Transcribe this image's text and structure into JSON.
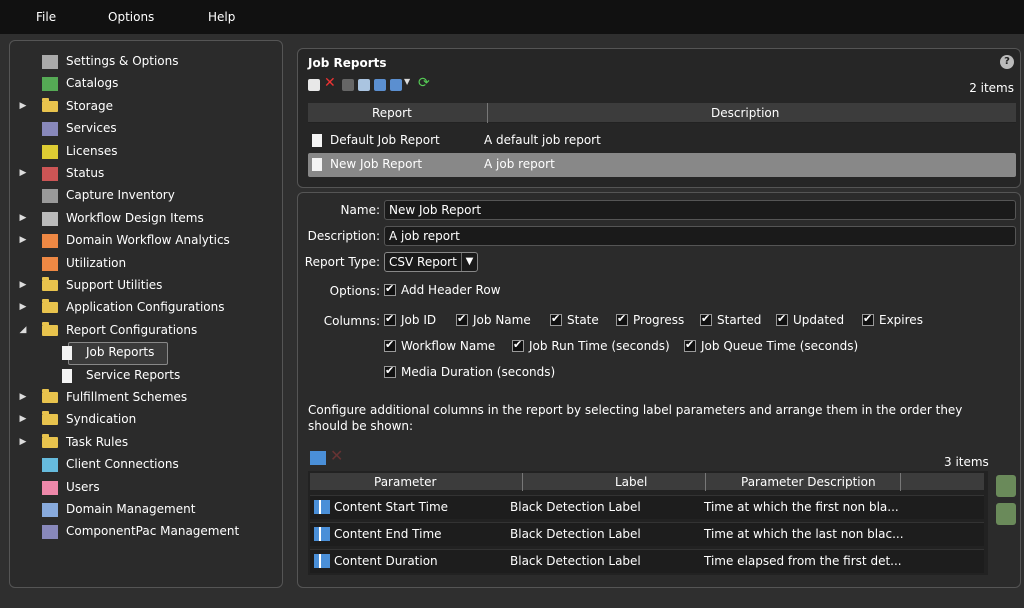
{
  "menu": {
    "file": "File",
    "options": "Options",
    "help": "Help"
  },
  "tree": [
    {
      "label": "Settings & Options",
      "icon": "settings-icon",
      "arrow": false
    },
    {
      "label": "Catalogs",
      "icon": "catalog-icon",
      "arrow": false
    },
    {
      "label": "Storage",
      "icon": "folder-icon",
      "arrow": true
    },
    {
      "label": "Services",
      "icon": "services-icon",
      "arrow": false
    },
    {
      "label": "Licenses",
      "icon": "key-icon",
      "arrow": false
    },
    {
      "label": "Status",
      "icon": "chart-icon",
      "arrow": true
    },
    {
      "label": "Capture Inventory",
      "icon": "capture-icon",
      "arrow": false
    },
    {
      "label": "Workflow Design Items",
      "icon": "workflow-icon",
      "arrow": true
    },
    {
      "label": "Domain Workflow Analytics",
      "icon": "analytics-icon",
      "arrow": true
    },
    {
      "label": "Utilization",
      "icon": "analytics-icon",
      "arrow": false
    },
    {
      "label": "Support Utilities",
      "icon": "folder-icon",
      "arrow": true
    },
    {
      "label": "Application Configurations",
      "icon": "folder-icon",
      "arrow": true
    },
    {
      "label": "Report Configurations",
      "icon": "folder-icon",
      "arrow": "open"
    },
    {
      "label": "Job Reports",
      "icon": "document-icon",
      "arrow": false,
      "child": true,
      "selected": true
    },
    {
      "label": "Service Reports",
      "icon": "document-icon",
      "arrow": false,
      "child": true
    },
    {
      "label": "Fulfillment Schemes",
      "icon": "folder-icon",
      "arrow": true
    },
    {
      "label": "Syndication",
      "icon": "folder-icon",
      "arrow": true
    },
    {
      "label": "Task Rules",
      "icon": "folder-icon",
      "arrow": true
    },
    {
      "label": "Client Connections",
      "icon": "monitor-icon",
      "arrow": false
    },
    {
      "label": "Users",
      "icon": "users-icon",
      "arrow": false
    },
    {
      "label": "Domain Management",
      "icon": "domain-icon",
      "arrow": false
    },
    {
      "label": "ComponentPac Management",
      "icon": "component-icon",
      "arrow": false
    }
  ],
  "job_reports": {
    "title": "Job Reports",
    "help": "?",
    "count": "2 items",
    "columns": {
      "report": "Report",
      "description": "Description"
    },
    "rows": [
      {
        "report": "Default Job Report",
        "description": "A default job report"
      },
      {
        "report": "New Job Report",
        "description": "A job report"
      }
    ]
  },
  "form": {
    "name_label": "Name:",
    "name_value": "New Job Report",
    "description_label": "Description:",
    "description_value": "A job report",
    "report_type_label": "Report Type:",
    "report_type_value": "CSV Report",
    "options_label": "Options:",
    "options": [
      "Add Header Row"
    ],
    "columns_label": "Columns:",
    "columns_row1": [
      "Job ID",
      "Job Name",
      "State",
      "Progress",
      "Started",
      "Updated",
      "Expires"
    ],
    "columns_row2": [
      "Workflow Name",
      "Job Run Time (seconds)",
      "Job Queue Time (seconds)"
    ],
    "columns_row3": [
      "Media Duration (seconds)"
    ],
    "instructions": "Configure additional columns in the report by selecting label parameters and arrange them in the order they should be shown:",
    "param_count": "3 items",
    "param_columns": {
      "parameter": "Parameter",
      "label": "Label",
      "description": "Parameter Description"
    },
    "params": [
      {
        "parameter": "Content Start Time",
        "label": "Black Detection Label",
        "description": "Time at which the first non bla..."
      },
      {
        "parameter": "Content End Time",
        "label": "Black Detection Label",
        "description": "Time at which the last non blac..."
      },
      {
        "parameter": "Content Duration",
        "label": "Black Detection Label",
        "description": "Time elapsed from the first det..."
      }
    ]
  }
}
